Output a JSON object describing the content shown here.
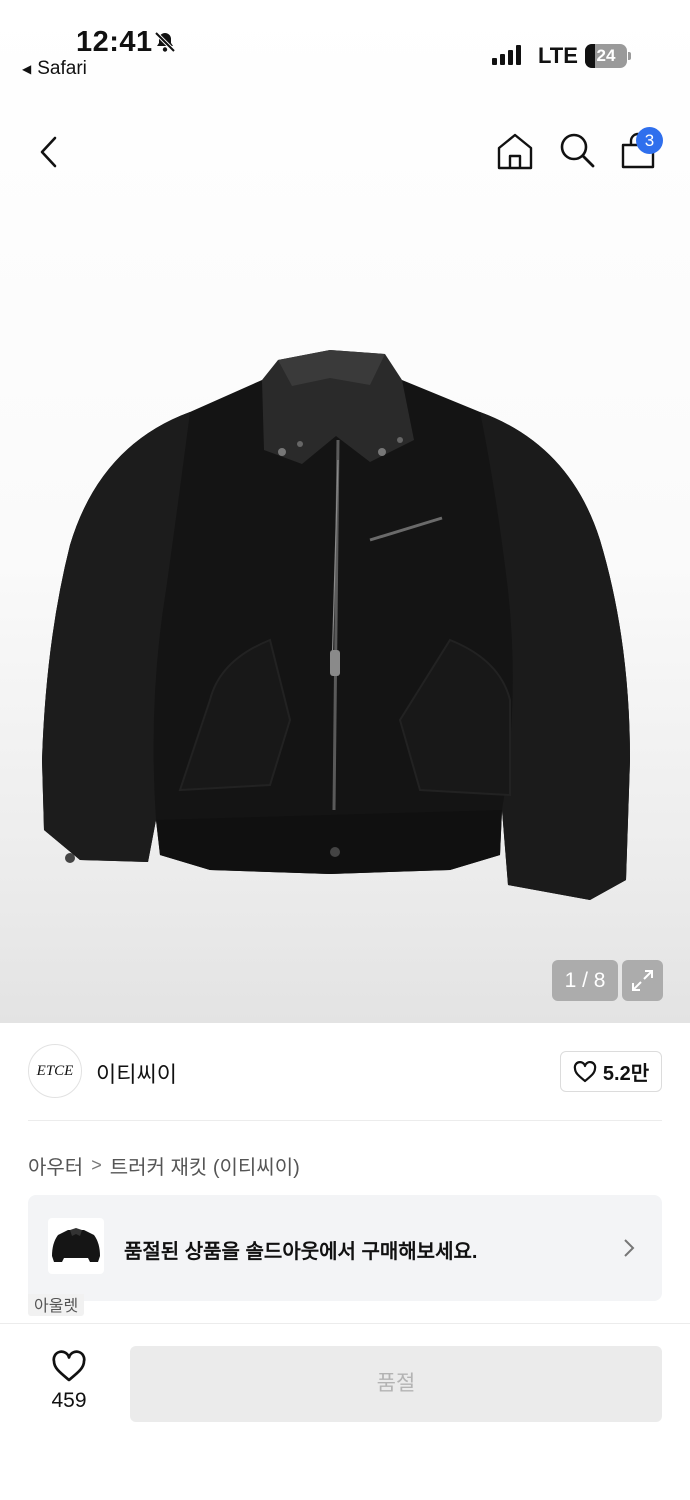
{
  "status_bar": {
    "time": "12:41",
    "back_app": "Safari",
    "network": "LTE",
    "battery": "24",
    "battery_level": 0.24
  },
  "nav": {
    "cart_count": "3"
  },
  "gallery": {
    "counter": "1 / 8"
  },
  "brand": {
    "logo_text": "ETCE",
    "name": "이티씨이",
    "likes": "5.2만"
  },
  "breadcrumb": {
    "category": "아우터",
    "product": "트러커 재킷 (이티씨이)"
  },
  "soldout_banner": {
    "text": "품절된 상품을 솔드아웃에서 구매해보세요."
  },
  "tag_peek": "아울렛",
  "bottom_bar": {
    "wish_count": "459",
    "soldout_label": "품절"
  }
}
